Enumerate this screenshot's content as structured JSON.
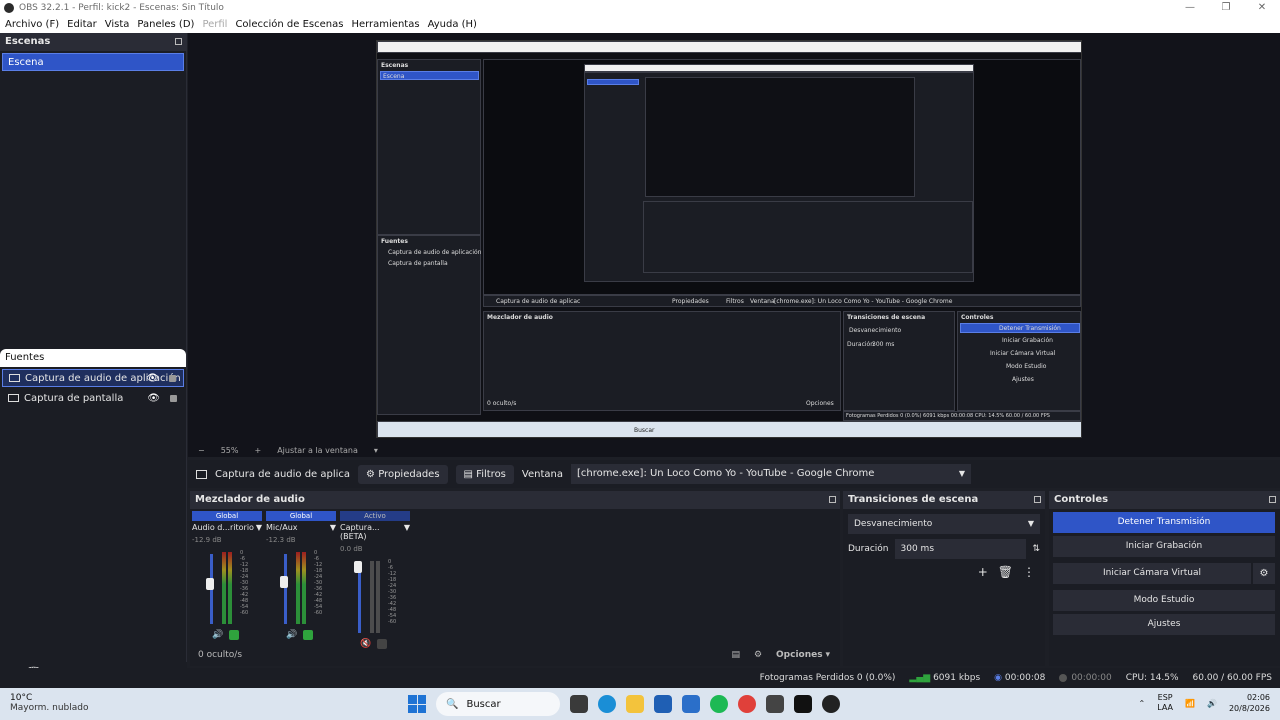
{
  "window": {
    "title": "OBS 32.2.1 - Perfil: kick2 - Escenas: Sin Título",
    "buttons": [
      "—",
      "❐",
      "✕"
    ]
  },
  "menu": {
    "items": [
      "Archivo (F)",
      "Editar",
      "Vista",
      "Paneles (D)",
      "Perfil",
      "Colección de Escenas",
      "Herramientas",
      "Ayuda (H)"
    ]
  },
  "scenes": {
    "title": "Escenas",
    "items": [
      "Escena"
    ]
  },
  "sources": {
    "title": "Fuentes",
    "items": [
      "Captura de audio de aplicación",
      "Captura de pantalla"
    ]
  },
  "preview": {
    "zoom": "55%",
    "fit_label": "Ajustar a la ventana",
    "nested": {
      "scenes_title": "Escenas",
      "scene_item": "Escena",
      "sources_title": "Fuentes",
      "source_1": "Captura de audio de aplicación",
      "source_2": "Captura de pantalla",
      "mixer_title": "Mezclador de audio",
      "transitions_title": "Transiciones de escena",
      "controls_title": "Controles",
      "prop_source": "Captura de audio de aplicac",
      "prop_props": "Propiedades",
      "prop_filters": "Filtros",
      "prop_window_label": "Ventana",
      "prop_window_value": "[chrome.exe]: Un Loco Como Yo - YouTube - Google Chrome",
      "trans_fade": "Desvanecimiento",
      "trans_dur_label": "Duración",
      "trans_dur": "300 ms",
      "ctrl_stop": "Detener Transmisión",
      "ctrl_rec": "Iniciar Grabación",
      "ctrl_vcam": "Iniciar Cámara Virtual",
      "ctrl_studio": "Modo Estudio",
      "ctrl_settings": "Ajustes",
      "hidden": "0 oculto/s",
      "options": "Opciones",
      "status": "Fotogramas Perdidos 0 (0.0%)   6091 kbps   00:00:08   CPU: 14.5%   60.00 / 60.00 FPS",
      "taskbar_search": "Buscar"
    }
  },
  "properties_bar": {
    "source_name": "Captura de audio de aplica",
    "properties_label": "Propiedades",
    "filters_label": "Filtros",
    "window_label": "Ventana",
    "window_value": "[chrome.exe]: Un Loco Como Yo - YouTube - Google Chrome"
  },
  "mixer": {
    "title": "Mezclador de audio",
    "channels": [
      {
        "header": "Global",
        "name": "Audio d...ritorio",
        "db": "-12.9 dB"
      },
      {
        "header": "Global",
        "name": "Mic/Aux",
        "db": "-12.3 dB"
      },
      {
        "header": "Activo",
        "name": "Captura... (BETA)",
        "db": "0.0 dB"
      }
    ],
    "scale": [
      "0",
      "-6",
      "-12",
      "-18",
      "-24",
      "-30",
      "-36",
      "-42",
      "-48",
      "-54",
      "-60"
    ],
    "hidden_count": "0 oculto/s",
    "options_label": "Opciones"
  },
  "transitions": {
    "title": "Transiciones de escena",
    "selected": "Desvanecimiento",
    "duration_label": "Duración",
    "duration_value": "300 ms"
  },
  "controls": {
    "title": "Controles",
    "stop_stream": "Detener Transmisión",
    "start_recording": "Iniciar Grabación",
    "start_virtual_cam": "Iniciar Cámara Virtual",
    "studio_mode": "Modo Estudio",
    "settings": "Ajustes"
  },
  "status": {
    "dropped_frames": "Fotogramas Perdidos 0 (0.0%)",
    "bitrate": "6091 kbps",
    "stream_time": "00:00:08",
    "rec_time": "00:00:00",
    "cpu": "CPU: 14.5%",
    "fps": "60.00 / 60.00 FPS"
  },
  "taskbar": {
    "temp": "10°C",
    "weather": "Mayorm. nublado",
    "search": "Buscar",
    "lang_1": "ESP",
    "lang_2": "LAA",
    "time": "02:06",
    "date": "20/8/2026"
  },
  "colors": {
    "accent": "#2f55c7",
    "panel": "#1b1d24",
    "header": "#2a2c36",
    "meter_green": "#2fa33d"
  }
}
